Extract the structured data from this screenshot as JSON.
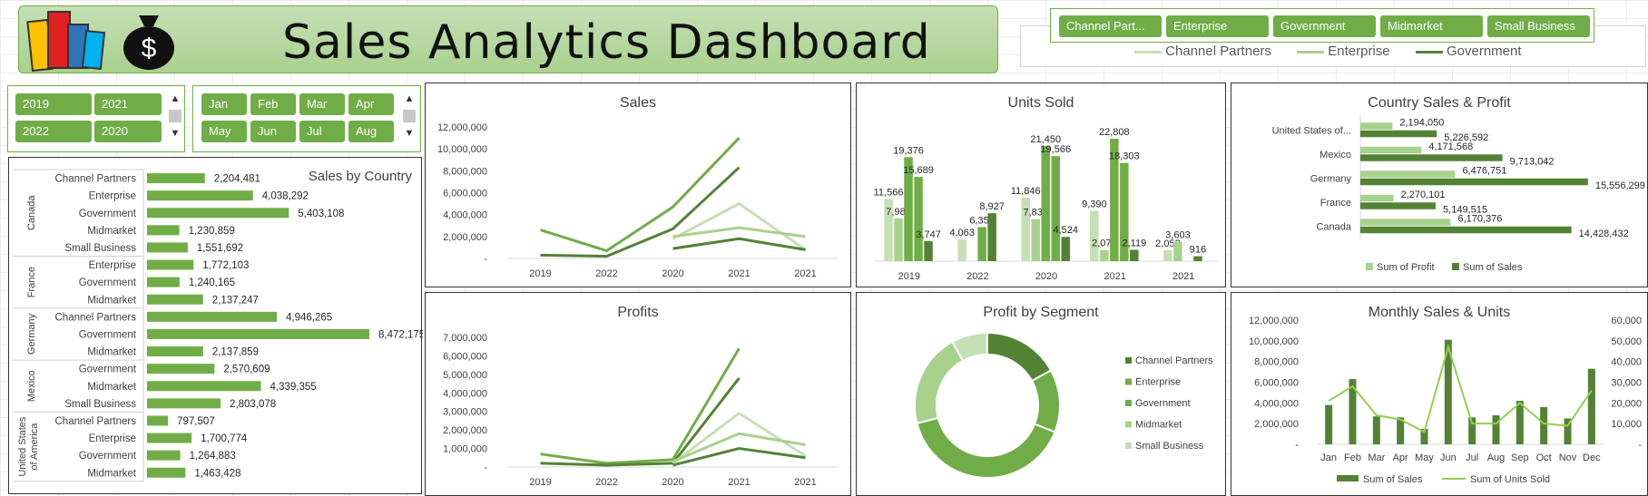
{
  "header": {
    "title": "Sales Analytics Dashboard",
    "logo_icons": [
      "bar-chart-logo-icon",
      "money-bag-icon"
    ],
    "money_symbol": "$"
  },
  "segment_filter": {
    "buttons": [
      "Channel Part...",
      "Enterprise",
      "Government",
      "Midmarket",
      "Small Business"
    ],
    "legend": [
      "Channel Partners",
      "Enterprise",
      "Government"
    ]
  },
  "year_slicer": {
    "items": [
      "2019",
      "2021",
      "2022",
      "2020"
    ]
  },
  "month_slicer": {
    "items": [
      "Jan",
      "Feb",
      "Mar",
      "Apr",
      "May",
      "Jun",
      "Jul",
      "Aug"
    ]
  },
  "colors": {
    "dark": "#548235",
    "mid": "#70ad47",
    "light": "#a9d18e",
    "pale": "#c5e0b4",
    "channel": "#548235",
    "enterprise": "#70ad47",
    "government": "#70ad47",
    "midmarket": "#a9d18e",
    "small": "#c5e0b4"
  },
  "sales_by_country": {
    "title": "Sales by  Country",
    "countries": [
      {
        "name": "Canada",
        "rows": [
          {
            "label": "Channel Partners",
            "value": 2204481,
            "text": "2,204,481"
          },
          {
            "label": "Enterprise",
            "value": 4038292,
            "text": "4,038,292"
          },
          {
            "label": "Government",
            "value": 5403108,
            "text": "5,403,108"
          },
          {
            "label": "Midmarket",
            "value": 1230859,
            "text": "1,230,859"
          },
          {
            "label": "Small Business",
            "value": 1551692,
            "text": "1,551,692"
          }
        ]
      },
      {
        "name": "France",
        "rows": [
          {
            "label": "Enterprise",
            "value": 1772103,
            "text": "1,772,103"
          },
          {
            "label": "Government",
            "value": 1240165,
            "text": "1,240,165"
          },
          {
            "label": "Midmarket",
            "value": 2137247,
            "text": "2,137,247"
          }
        ]
      },
      {
        "name": "Germany",
        "rows": [
          {
            "label": "Channel Partners",
            "value": 4946265,
            "text": "4,946,265"
          },
          {
            "label": "Government",
            "value": 8472175,
            "text": "8,472,175"
          },
          {
            "label": "Midmarket",
            "value": 2137859,
            "text": "2,137,859"
          }
        ]
      },
      {
        "name": "Mexico",
        "rows": [
          {
            "label": "Government",
            "value": 2570609,
            "text": "2,570,609"
          },
          {
            "label": "Midmarket",
            "value": 4339355,
            "text": "4,339,355"
          },
          {
            "label": "Small Business",
            "value": 2803078,
            "text": "2,803,078"
          }
        ]
      },
      {
        "name": "United States of America",
        "rows": [
          {
            "label": "Channel Partners",
            "value": 797507,
            "text": "797,507"
          },
          {
            "label": "Enterprise",
            "value": 1700774,
            "text": "1,700,774"
          },
          {
            "label": "Government",
            "value": 1264883,
            "text": "1,264,883"
          },
          {
            "label": "Midmarket",
            "value": 1463428,
            "text": "1,463,428"
          }
        ]
      }
    ]
  },
  "chart_data": [
    {
      "id": "sales",
      "type": "line",
      "title": "Sales",
      "categories": [
        "2019",
        "2022",
        "2020",
        "2021",
        "2021"
      ],
      "y_ticks": [
        "12,000,000",
        "10,000,000",
        "8,000,000",
        "6,000,000",
        "4,000,000",
        "2,000,000",
        "-"
      ],
      "ylim": [
        0,
        12000000
      ],
      "series": [
        {
          "values": [
            2600000,
            700000,
            4700000,
            11000000,
            null
          ],
          "color": "#70ad47"
        },
        {
          "values": [
            300000,
            200000,
            2700000,
            8300000,
            null
          ],
          "color": "#548235"
        },
        {
          "values": [
            null,
            null,
            1800000,
            5000000,
            800000
          ],
          "color": "#c5e0b4"
        },
        {
          "values": [
            null,
            null,
            2000000,
            2800000,
            2000000
          ],
          "color": "#a9d18e"
        },
        {
          "values": [
            null,
            null,
            900000,
            1800000,
            800000
          ],
          "color": "#548235"
        }
      ]
    },
    {
      "id": "profits",
      "type": "line",
      "title": "Profits",
      "categories": [
        "2019",
        "2022",
        "2020",
        "2021",
        "2021"
      ],
      "y_ticks": [
        "7,000,000",
        "6,000,000",
        "5,000,000",
        "4,000,000",
        "3,000,000",
        "2,000,000",
        "1,000,000",
        "-"
      ],
      "ylim": [
        0,
        7000000
      ],
      "series": [
        {
          "values": [
            700000,
            200000,
            400000,
            6400000,
            null
          ],
          "color": "#70ad47"
        },
        {
          "values": [
            200000,
            100000,
            200000,
            4800000,
            null
          ],
          "color": "#548235"
        },
        {
          "values": [
            null,
            null,
            200000,
            2900000,
            600000
          ],
          "color": "#c5e0b4"
        },
        {
          "values": [
            null,
            null,
            300000,
            1800000,
            1200000
          ],
          "color": "#a9d18e"
        },
        {
          "values": [
            null,
            null,
            100000,
            1000000,
            500000
          ],
          "color": "#548235"
        }
      ]
    },
    {
      "id": "units",
      "type": "bar",
      "title": "Units Sold",
      "categories": [
        "2019",
        "2022",
        "2020",
        "2021",
        "2021"
      ],
      "ylim": [
        0,
        25000
      ],
      "groups": [
        [
          {
            "value": 11566,
            "label": "11,566",
            "color": "#c5e0b4"
          },
          {
            "value": 7981,
            "label": "7,981",
            "color": "#a9d18e"
          },
          {
            "value": 19376,
            "label": "19,376",
            "color": "#70ad47"
          },
          {
            "value": 15689,
            "label": "15,689",
            "color": "#70ad47"
          },
          {
            "value": 3747,
            "label": "3,747",
            "color": "#548235"
          }
        ],
        [
          {
            "value": 4063,
            "label": "4,063",
            "color": "#c5e0b4"
          },
          {
            "value": 0,
            "label": "",
            "color": "#c5e0b4"
          },
          {
            "value": 6352,
            "label": "6,352",
            "color": "#70ad47"
          },
          {
            "value": 8927,
            "label": "8,927",
            "color": "#548235"
          }
        ],
        [
          {
            "value": 11846,
            "label": "11,846",
            "color": "#c5e0b4"
          },
          {
            "value": 7836,
            "label": "7,836",
            "color": "#a9d18e"
          },
          {
            "value": 21450,
            "label": "21,450",
            "color": "#70ad47"
          },
          {
            "value": 19566,
            "label": "19,566",
            "color": "#70ad47"
          },
          {
            "value": 4524,
            "label": "4,524",
            "color": "#548235"
          }
        ],
        [
          {
            "value": 9390,
            "label": "9,390",
            "color": "#c5e0b4"
          },
          {
            "value": 2078,
            "label": "2,078",
            "color": "#a9d18e"
          },
          {
            "value": 22808,
            "label": "22,808",
            "color": "#70ad47"
          },
          {
            "value": 18303,
            "label": "18,303",
            "color": "#70ad47"
          },
          {
            "value": 2119,
            "label": "2,119",
            "color": "#548235"
          }
        ],
        [
          {
            "value": 2053,
            "label": "2,053",
            "color": "#c5e0b4"
          },
          {
            "value": 3603,
            "label": "3,603",
            "color": "#a9d18e"
          },
          {
            "value": 0,
            "label": "",
            "color": "#70ad47"
          },
          {
            "value": 916,
            "label": "916",
            "color": "#548235"
          }
        ]
      ]
    },
    {
      "id": "country",
      "type": "bar",
      "orientation": "horizontal",
      "title": "Country Sales & Profit",
      "categories": [
        "United States of...",
        "Mexico",
        "Germany",
        "France",
        "Canada"
      ],
      "series": [
        {
          "name": "Sum of Profit",
          "values": [
            2194050,
            4171568,
            6476751,
            2270101,
            6170376
          ],
          "labels": [
            "2,194,050",
            "4,171,568",
            "6,476,751",
            "2,270,101",
            "6,170,376"
          ],
          "color": "#a9d18e"
        },
        {
          "name": "Sum of  Sales",
          "values": [
            5226592,
            9713042,
            15556299,
            5149515,
            14428432
          ],
          "labels": [
            "5,226,592",
            "9,713,042",
            "15,556,299",
            "5,149,515",
            "14,428,432"
          ],
          "color": "#548235"
        }
      ],
      "xlim": [
        0,
        16000000
      ]
    },
    {
      "id": "segment",
      "type": "pie",
      "title": "Profit by Segment",
      "labels": [
        "Channel Partners",
        "Enterprise",
        "Government",
        "Midmarket",
        "Small Business"
      ],
      "values": [
        17,
        14,
        40,
        21,
        8
      ],
      "colors": [
        "#548235",
        "#70ad47",
        "#70ad47",
        "#a9d18e",
        "#c5e0b4"
      ]
    },
    {
      "id": "monthly",
      "type": "bar",
      "title": "Monthly Sales & Units",
      "categories": [
        "Jan",
        "Feb",
        "Mar",
        "Apr",
        "May",
        "Jun",
        "Jul",
        "Aug",
        "Sep",
        "Oct",
        "Nov",
        "Dec"
      ],
      "y_ticks": [
        "12,000,000",
        "10,000,000",
        "8,000,000",
        "6,000,000",
        "4,000,000",
        "2,000,000",
        "-"
      ],
      "y2_ticks": [
        "60,000",
        "50,000",
        "40,000",
        "30,000",
        "20,000",
        "10,000",
        "-"
      ],
      "ylim": [
        0,
        12000000
      ],
      "y2lim": [
        0,
        60000
      ],
      "series": [
        {
          "name": "Sum of  Sales",
          "type": "bar",
          "values": [
            3800000,
            6300000,
            2700000,
            2600000,
            1500000,
            10100000,
            2600000,
            2800000,
            4200000,
            3600000,
            2500000,
            7300000
          ],
          "color": "#548235"
        },
        {
          "name": "Sum of Units Sold",
          "type": "line",
          "values": [
            21000,
            28000,
            14000,
            12000,
            6000,
            47000,
            10000,
            10000,
            20000,
            10000,
            9000,
            26000
          ],
          "color": "#92d050"
        }
      ]
    }
  ]
}
